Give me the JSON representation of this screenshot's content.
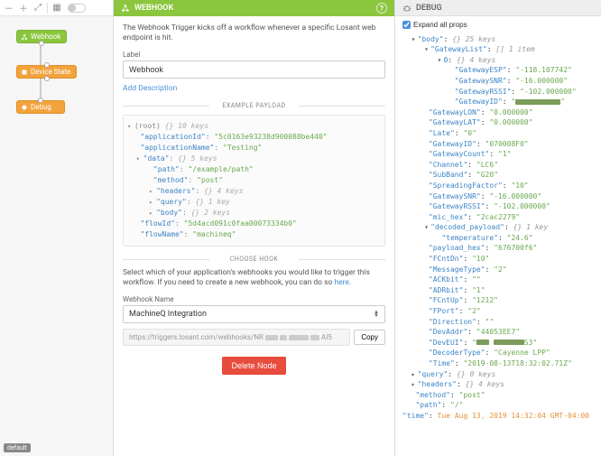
{
  "toolbar": {
    "default_badge": "default"
  },
  "canvas": {
    "nodes": [
      {
        "label": "Webhook"
      },
      {
        "label": "Device State"
      },
      {
        "label": "Debug"
      }
    ]
  },
  "center": {
    "title": "WEBHOOK",
    "description": "The Webhook Trigger kicks off a workflow whenever a specific Losant web endpoint is hit.",
    "label_field": "Label",
    "label_value": "Webhook",
    "add_description": "Add Description",
    "section_example": "EXAMPLE PAYLOAD",
    "section_choose": "CHOOSE HOOK",
    "choose_desc_1": "Select which of your application's webhooks you would like to trigger this workflow. If you need to create a new webhook, you can do so ",
    "choose_desc_here": "here",
    "choose_desc_2": ".",
    "webhook_name_label": "Webhook Name",
    "webhook_name_value": "MachineQ Integration",
    "url_prefix": "https://triggers.losant.com/webhooks/NR",
    "url_suffix": "AI5",
    "copy": "Copy",
    "delete": "Delete Node",
    "payload": {
      "root_comment": "10 keys",
      "applicationId": "5c0163e93238d900088be440",
      "applicationName": "Testing",
      "data_comment": "5 keys",
      "path": "/example/path",
      "method": "post",
      "headers_comment": "4 keys",
      "query_comment": "1 key",
      "body_comment": "2 keys",
      "flowId": "5d4acd091c0faa00073334b0",
      "flowName": "machineq"
    }
  },
  "debug": {
    "title": "DEBUG",
    "expand_label": "Expand all props",
    "body_comment": "25 keys",
    "gatewaylist_comment": "1 item",
    "item0_comment": "4 keys",
    "GatewayESP": "-118.107742",
    "GatewaySNR0": "-16.000000",
    "GatewayRSSI0": "-102.000000",
    "GatewayID0": "",
    "GatewayLON": "0.000000",
    "GatewayLAT": "0.000000",
    "Late": "0",
    "GatewayID": "070008F0",
    "GatewayCount": "1",
    "Channel": "LC6",
    "SubBand": "G20",
    "SpreadingFactor": "10",
    "GatewaySNR": "-16.000000",
    "GatewayRSSI": "-102.000000",
    "mic_hex": "2cac2279",
    "decoded_comment": "1 key",
    "temperature": "24.6",
    "payload_hex": "676700f6",
    "FCntDn": "10",
    "MessageType": "2",
    "ACKbit": "",
    "ADRbit": "1",
    "FCntUp": "1212",
    "FPort": "2",
    "Direction": "",
    "DevAddr": "44053EE7",
    "DevEUI": "",
    "DecoderType": "Cayenne LPP",
    "Time": "2019-08-13T18:32:02.71Z",
    "query_comment": "0 keys",
    "headers_comment": "4 keys",
    "method": "post",
    "path": "/",
    "time_footer": "Tue Aug 13, 2019 14:32:04 GMT-04:00"
  }
}
